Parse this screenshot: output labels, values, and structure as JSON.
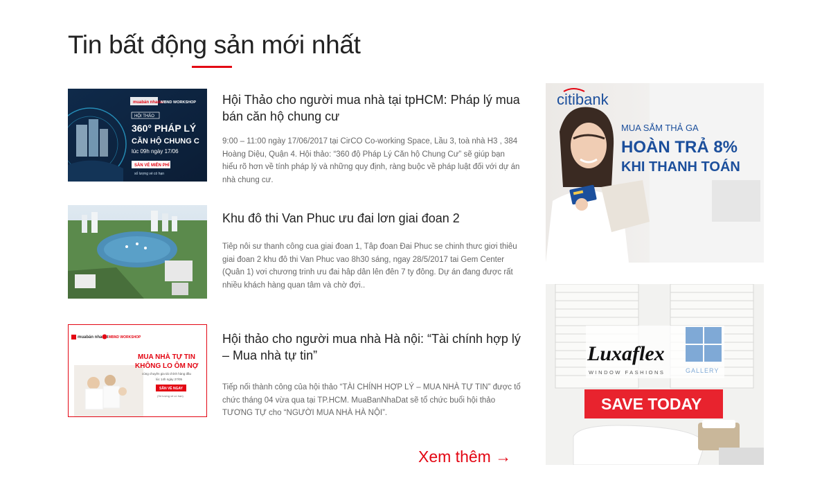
{
  "section": {
    "title": "Tin bất động sản mới nhất"
  },
  "articles": [
    {
      "title": "Hội Thảo cho người mua nhà tại tpHCM: Pháp lý mua bán căn hộ chung cư",
      "excerpt": "9:00 – 11:00 ngày 17/06/2017 tại CirCO Co-working Space, Lầu 3, toà nhà H3 , 384 Hoàng Diệu, Quận 4. Hội thảo: “360 độ Pháp Lý Căn hộ Chung Cư” sẽ giúp bạn hiểu rõ hơn về tính pháp lý và những quy định, ràng buộc về pháp luật đối với dự án nhà chung cư.",
      "thumb": {
        "brand": "muabán nhadat",
        "workshop": "MBND WORKSHOP",
        "event": "HỘI THẢO",
        "headline1": "360° PHÁP LÝ",
        "headline2": "CĂN HỘ CHUNG C",
        "time": "lúc 09h ngày 17/06",
        "cta": "SÀN VÉ MIỄN PHÍ",
        "note": "số lượng vé có hạn"
      }
    },
    {
      "title": "Khu đô thi Van Phuc ưu đai lơn giai đoan 2",
      "excerpt": "Tiêp nôi sư thanh công cua giai đoan 1, Tâp đoan Đai Phuc se chinh thưc giơi thiêu giai đoan 2 khu đô thi Van Phuc vao 8h30 sáng, ngay 28/5/2017 tai Gem Center (Quân 1) vơi chương trinh ưu đai hâp dân lên đên 7 ty đông. Dự án đang được rất nhiều khách hàng quan tâm và chờ đợi.."
    },
    {
      "title": "Hội thảo cho người mua nhà Hà nội: “Tài chính hợp lý – Mua nhà tự tin”",
      "excerpt": "Tiếp nối thành công của hội thảo “TÀI CHÍNH HỢP LÝ – MUA NHÀ TỰ TIN” được tổ chức tháng 04 vừa qua tại TP.HCM. MuaBanNhaDat sẽ tổ chức buổi hội thảo TƯƠNG TỰ cho “NGƯỜI MUA NHÀ HÀ NỘI”.",
      "thumb": {
        "brand": "muabán nhadat",
        "workshop": "MBND WORKSHOP",
        "headline1": "MUA NHÀ TỰ TIN",
        "headline2": "KHÔNG LO ÔM NỢ",
        "sub": "cùng chuyên gia tài chính hàng đầu",
        "time": "lúc 14h ngày 27/05",
        "cta": "SĂN VÉ NGAY",
        "note": "(Số lượng vé có hạn)"
      }
    }
  ],
  "more": {
    "label": "Xem thêm",
    "arrow": "→"
  },
  "ads": [
    {
      "brand": "citibank",
      "line1": "MUA SẮM THẢ GA",
      "line2": "HOÀN TRẢ 8%",
      "line3": "KHI THANH TOÁN"
    },
    {
      "brand": "Luxaflex",
      "tagline": "WINDOW FASHIONS",
      "gallery": "GALLERY",
      "cta": "SAVE TODAY"
    }
  ],
  "colors": {
    "accent": "#e30613",
    "text": "#222222",
    "muted": "#666666",
    "citi_blue": "#1c4f9c"
  }
}
